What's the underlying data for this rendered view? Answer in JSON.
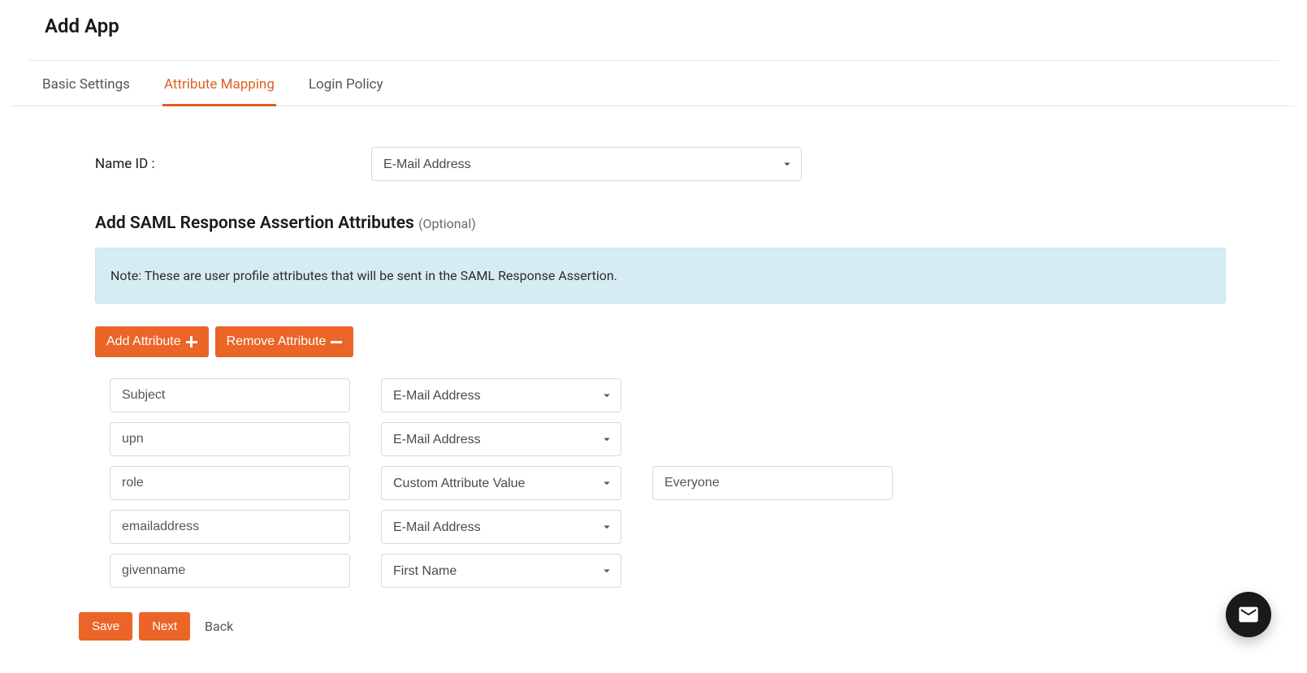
{
  "header": {
    "title": "Add App"
  },
  "tabs": [
    {
      "label": "Basic Settings",
      "active": false
    },
    {
      "label": "Attribute Mapping",
      "active": true
    },
    {
      "label": "Login Policy",
      "active": false
    }
  ],
  "nameid": {
    "label": "Name ID :",
    "value": "E-Mail Address"
  },
  "assertion_section": {
    "heading": "Add SAML Response Assertion Attributes",
    "optional": "(Optional)",
    "note": "Note: These are user profile attributes that will be sent in the SAML Response Assertion."
  },
  "buttons": {
    "add_attribute": "Add Attribute",
    "remove_attribute": "Remove Attribute",
    "save": "Save",
    "next": "Next",
    "back": "Back"
  },
  "attributes": [
    {
      "name": "Subject",
      "mapping": "E-Mail Address",
      "custom": null
    },
    {
      "name": "upn",
      "mapping": "E-Mail Address",
      "custom": null
    },
    {
      "name": "role",
      "mapping": "Custom Attribute Value",
      "custom": "Everyone"
    },
    {
      "name": "emailaddress",
      "mapping": "E-Mail Address",
      "custom": null
    },
    {
      "name": "givenname",
      "mapping": "First Name",
      "custom": null
    }
  ]
}
